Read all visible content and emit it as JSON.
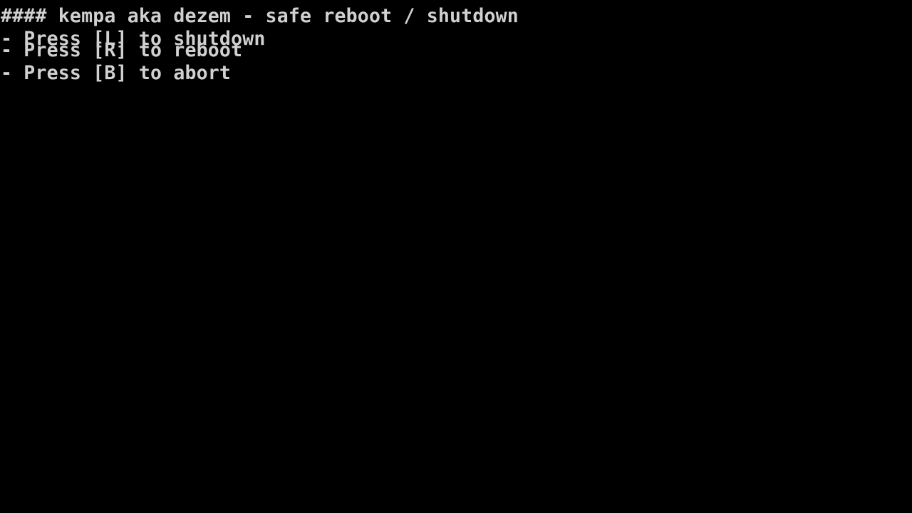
{
  "screen": {
    "background": "#000000",
    "text_color": "#d0d0d0",
    "title": "#### kempa aka dezem - safe reboot / shutdown",
    "options": [
      {
        "text": "- Press [L] to shutdown",
        "key": "L",
        "action": "shutdown"
      },
      {
        "text": "- Press [R] to reboot",
        "key": "R",
        "action": "reboot"
      },
      {
        "text": "- Press [B] to abort",
        "key": "B",
        "action": "abort"
      }
    ]
  }
}
